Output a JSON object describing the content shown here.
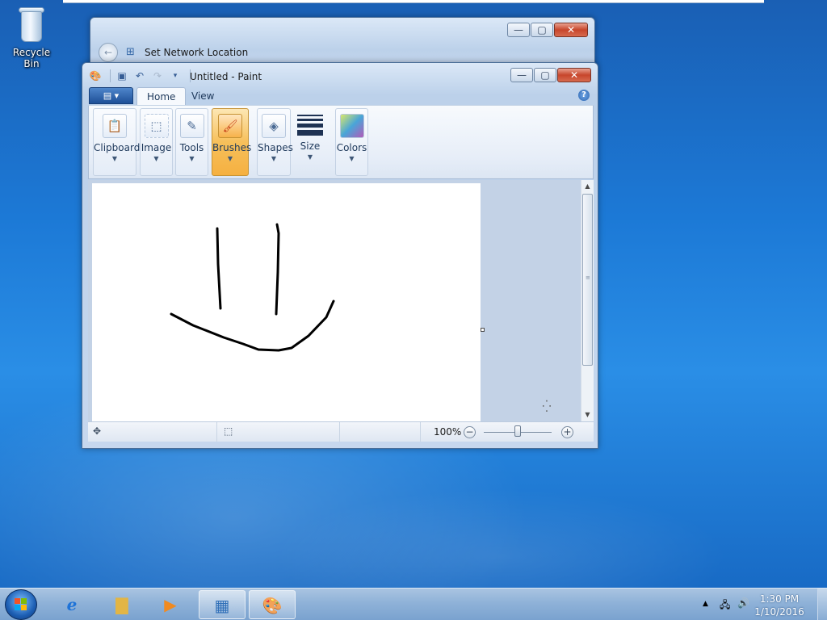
{
  "desktop": {
    "icons": [
      {
        "label": "Recycle Bin",
        "icon": "recycle-bin-icon"
      }
    ]
  },
  "network_window": {
    "title": "Set Network Location",
    "buttons": {
      "minimize": "—",
      "maximize": "▢",
      "close": "✕"
    }
  },
  "paint_window": {
    "title": "Untitled - Paint",
    "quick_access": [
      "save-icon",
      "undo-icon",
      "redo-icon",
      "customize-icon"
    ],
    "buttons": {
      "minimize": "—",
      "maximize": "▢",
      "close": "✕"
    },
    "tabs": [
      {
        "label": "Home",
        "active": true
      },
      {
        "label": "View",
        "active": false
      }
    ],
    "help": "?",
    "ribbon": {
      "groups": [
        {
          "label": "Clipboard",
          "icon": "clipboard-icon",
          "active": false
        },
        {
          "label": "Image",
          "icon": "image-select-icon",
          "active": false
        },
        {
          "label": "Tools",
          "icon": "tools-icon",
          "active": false
        },
        {
          "label": "Brushes",
          "icon": "brush-icon",
          "active": true
        },
        {
          "label": "Shapes",
          "icon": "shapes-icon",
          "active": false
        },
        {
          "label": "Size",
          "icon": "size-icon",
          "active": false
        },
        {
          "label": "Colors",
          "icon": "colors-icon",
          "active": false
        }
      ]
    },
    "statusbar": {
      "zoom": "100%",
      "zoom_out": "−",
      "zoom_in": "+"
    }
  },
  "taskbar": {
    "items": [
      {
        "name": "internet-explorer",
        "icon": "ie-icon",
        "open": false
      },
      {
        "name": "file-explorer",
        "icon": "folder-icon",
        "open": false
      },
      {
        "name": "media-player",
        "icon": "media-player-icon",
        "open": false
      },
      {
        "name": "network-settings",
        "icon": "control-panel-icon",
        "open": true
      },
      {
        "name": "paint",
        "icon": "paint-icon",
        "open": true
      }
    ],
    "clock": {
      "time": "1:30 PM",
      "date": "1/10/2016"
    }
  },
  "colors": {
    "accent": "#1d4f97",
    "active_group": "#f7c05b",
    "close_button": "#c7462c"
  }
}
